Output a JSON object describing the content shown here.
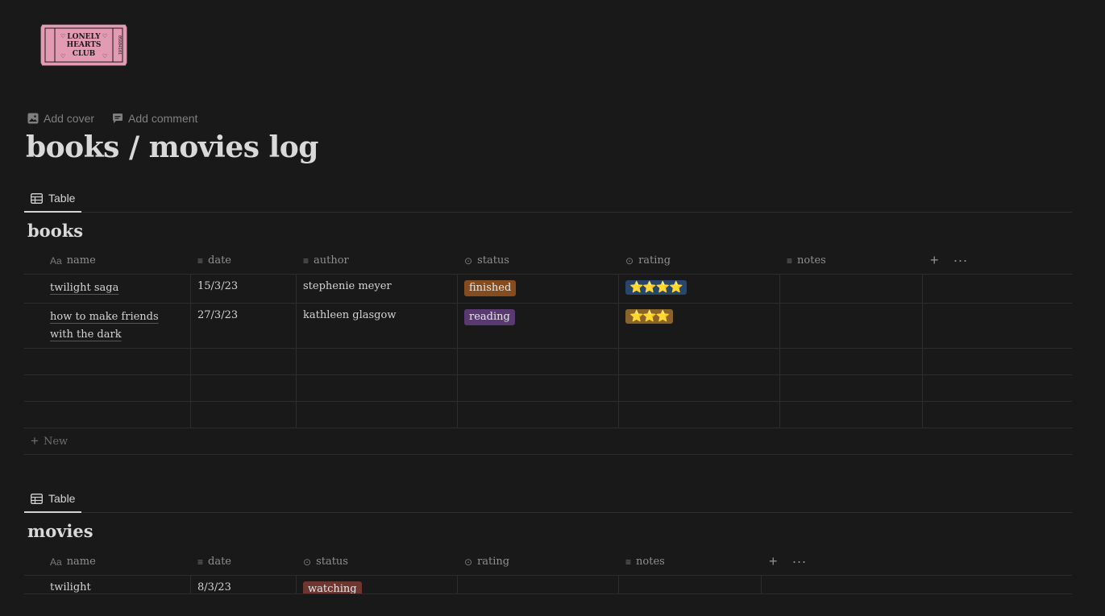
{
  "logo": {
    "line1": "LONELY",
    "line2": "HEARTS",
    "line3": "CLUB",
    "serial": "05604101",
    "colors": {
      "fill": "#e39bb3",
      "ink": "#1a1a1a"
    }
  },
  "page_actions": {
    "add_cover": "Add cover",
    "add_comment": "Add comment"
  },
  "page_title": "books / movies log",
  "books": {
    "view_tab": "Table",
    "title": "books",
    "columns": [
      {
        "label": "name",
        "icon": "text-aa-icon"
      },
      {
        "label": "date",
        "icon": "text-lines-icon"
      },
      {
        "label": "author",
        "icon": "text-lines-icon"
      },
      {
        "label": "status",
        "icon": "select-icon"
      },
      {
        "label": "rating",
        "icon": "select-icon"
      },
      {
        "label": "notes",
        "icon": "text-lines-icon"
      }
    ],
    "rows": [
      {
        "name": "twilight saga",
        "date": "15/3/23",
        "author": "stephenie meyer",
        "status": "finished",
        "status_color": "#854c1d",
        "rating": "⭐⭐⭐⭐",
        "rating_color": "#28456c",
        "notes": ""
      },
      {
        "name": "how to make friends with the dark",
        "date": "27/3/23",
        "author": "kathleen glasgow",
        "status": "reading",
        "status_color": "#5a3872",
        "rating": "⭐⭐⭐",
        "rating_color": "#89632a",
        "notes": ""
      }
    ],
    "new_label": "New"
  },
  "movies": {
    "view_tab": "Table",
    "title": "movies",
    "columns": [
      {
        "label": "name",
        "icon": "text-aa-icon"
      },
      {
        "label": "date",
        "icon": "text-lines-icon"
      },
      {
        "label": "status",
        "icon": "select-icon"
      },
      {
        "label": "rating",
        "icon": "select-icon"
      },
      {
        "label": "notes",
        "icon": "text-lines-icon"
      }
    ],
    "rows": [
      {
        "name": "twilight",
        "date": "8/3/23",
        "status": "watching",
        "status_color": "#6e3630",
        "rating": "",
        "notes": ""
      }
    ]
  }
}
